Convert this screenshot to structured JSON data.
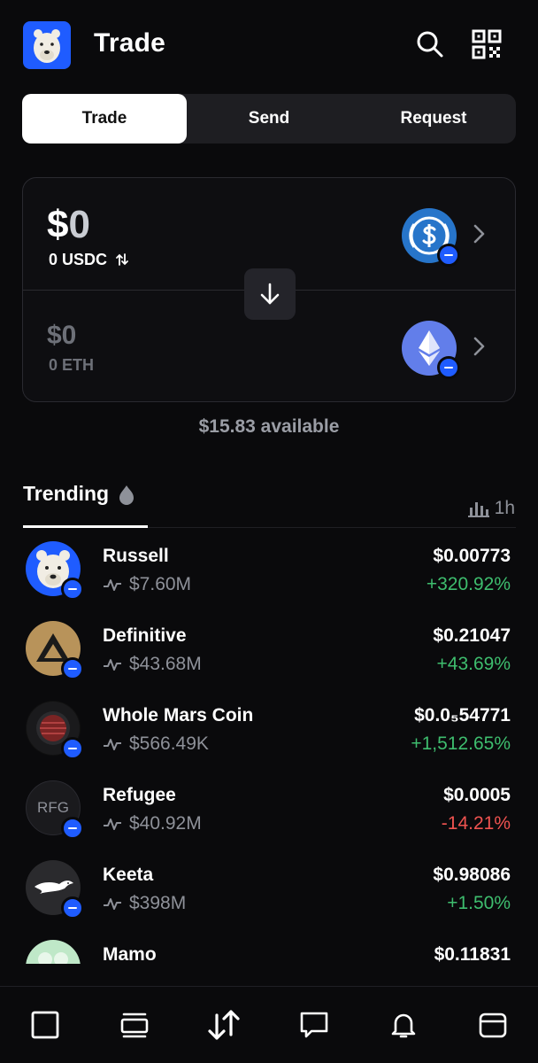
{
  "header": {
    "title": "Trade"
  },
  "tabs": [
    {
      "label": "Trade",
      "active": true
    },
    {
      "label": "Send",
      "active": false
    },
    {
      "label": "Request",
      "active": false
    }
  ],
  "swap": {
    "from": {
      "amount_prefix": "$",
      "amount_value": "0",
      "sub": "0 USDC"
    },
    "to": {
      "amount": "$0",
      "sub": "0 ETH"
    },
    "available": "$15.83 available"
  },
  "trending": {
    "label": "Trending",
    "timeframe": "1h"
  },
  "tokens": [
    {
      "name": "Russell",
      "mcap": "$7.60M",
      "price": "$0.00773",
      "change": "+320.92%",
      "direction": "up"
    },
    {
      "name": "Definitive",
      "mcap": "$43.68M",
      "price": "$0.21047",
      "change": "+43.69%",
      "direction": "up"
    },
    {
      "name": "Whole Mars Coin",
      "mcap": "$566.49K",
      "price": "$0.0₅54771",
      "change": "+1,512.65%",
      "direction": "up"
    },
    {
      "name": "Refugee",
      "avatar_text": "RFG",
      "mcap": "$40.92M",
      "price": "$0.0005",
      "change": "-14.21%",
      "direction": "down"
    },
    {
      "name": "Keeta",
      "mcap": "$398M",
      "price": "$0.98086",
      "change": "+1.50%",
      "direction": "up"
    },
    {
      "name": "Mamo",
      "mcap": "",
      "price": "$0.11831",
      "change": "",
      "direction": "up"
    }
  ],
  "colors": {
    "accent": "#1f5cff",
    "positive": "#3ebd6e",
    "negative": "#ef5350",
    "background": "#0a0a0c"
  },
  "icons": {
    "header": [
      "search-icon",
      "qr-code-icon"
    ],
    "nav": [
      "square-icon",
      "stack-icon",
      "swap-arrows-icon",
      "chat-icon",
      "bell-icon",
      "wallet-icon"
    ]
  }
}
